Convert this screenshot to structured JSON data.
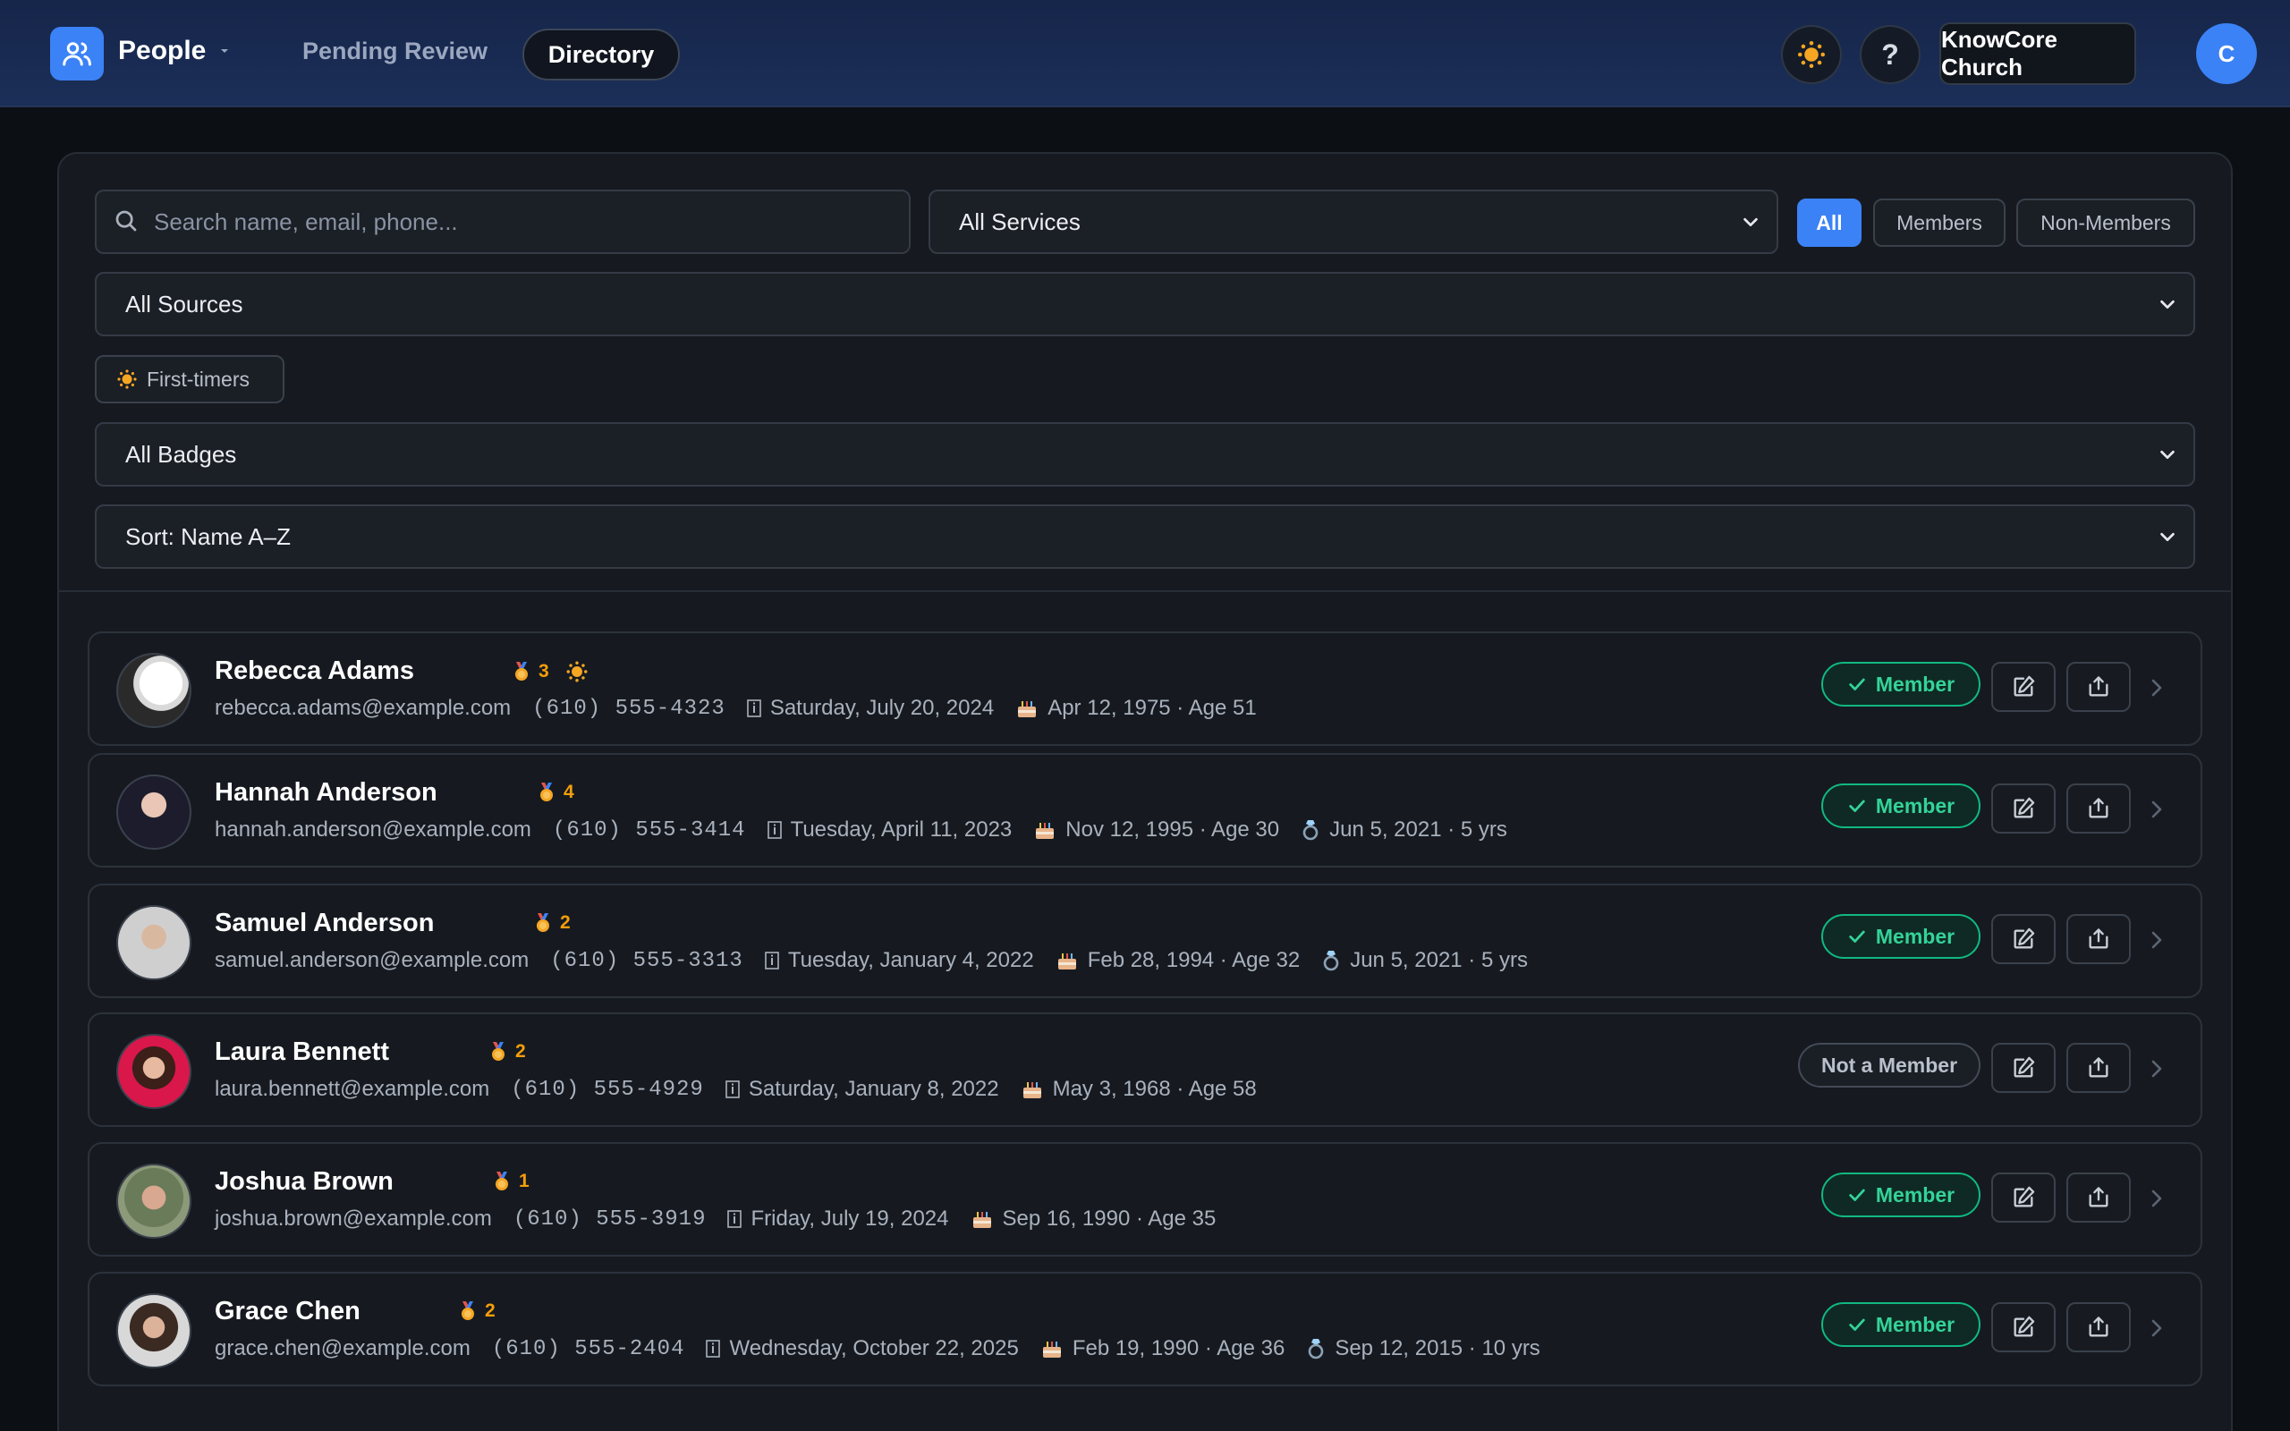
{
  "header": {
    "app_title": "People",
    "nav": {
      "pending": "Pending Review",
      "directory": "Directory"
    },
    "help_label": "?",
    "org_name": "KnowCore Church",
    "user_initial": "C"
  },
  "filters": {
    "search_placeholder": "Search name, email, phone...",
    "services": "All Services",
    "membership_tabs": [
      "All",
      "Members",
      "Non-Members"
    ],
    "active_membership_tab": "All",
    "sources": "All Sources",
    "first_timers_label": "First-timers",
    "badges": "All Badges",
    "sort": "Sort: Name A–Z"
  },
  "colors": {
    "accent": "#3b82f6",
    "member_green": "#34d399",
    "badge_orange": "#f59e0b"
  },
  "people": [
    {
      "name": "Rebecca Adams",
      "badge_count": "3",
      "first_timer": true,
      "email": "rebecca.adams@example.com",
      "phone": "(610) 555-4323",
      "joined": "Saturday, July 20, 2024",
      "birthday": "Apr 12, 1975 · Age 51",
      "anniversary": "",
      "status": "Member"
    },
    {
      "name": "Hannah Anderson",
      "badge_count": "4",
      "first_timer": false,
      "email": "hannah.anderson@example.com",
      "phone": "(610) 555-3414",
      "joined": "Tuesday, April 11, 2023",
      "birthday": "Nov 12, 1995 · Age 30",
      "anniversary": "Jun 5, 2021 · 5 yrs",
      "status": "Member"
    },
    {
      "name": "Samuel Anderson",
      "badge_count": "2",
      "first_timer": false,
      "email": "samuel.anderson@example.com",
      "phone": "(610) 555-3313",
      "joined": "Tuesday, January 4, 2022",
      "birthday": "Feb 28, 1994 · Age 32",
      "anniversary": "Jun 5, 2021 · 5 yrs",
      "status": "Member"
    },
    {
      "name": "Laura Bennett",
      "badge_count": "2",
      "first_timer": false,
      "email": "laura.bennett@example.com",
      "phone": "(610) 555-4929",
      "joined": "Saturday, January 8, 2022",
      "birthday": "May 3, 1968 · Age 58",
      "anniversary": "",
      "status": "Not a Member"
    },
    {
      "name": "Joshua Brown",
      "badge_count": "1",
      "first_timer": false,
      "email": "joshua.brown@example.com",
      "phone": "(610) 555-3919",
      "joined": "Friday, July 19, 2024",
      "birthday": "Sep 16, 1990 · Age 35",
      "anniversary": "",
      "status": "Member"
    },
    {
      "name": "Grace Chen",
      "badge_count": "2",
      "first_timer": false,
      "email": "grace.chen@example.com",
      "phone": "(610) 555-2404",
      "joined": "Wednesday, October 22, 2025",
      "birthday": "Feb 19, 1990 · Age 36",
      "anniversary": "Sep 12, 2015 · 10 yrs",
      "status": "Member"
    }
  ]
}
